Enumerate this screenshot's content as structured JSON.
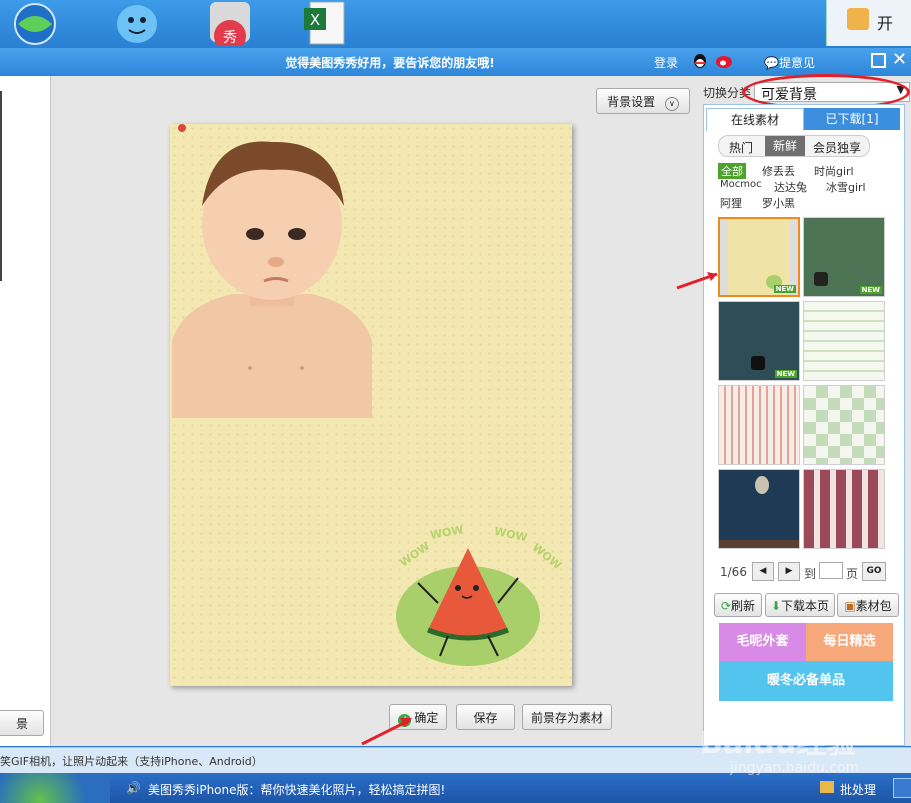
{
  "desktop": {
    "partial_label": "开",
    "icons": [
      "globe-icon",
      "qq-penguin-icon",
      "meitu-icon",
      "excel-icon"
    ]
  },
  "dialog": {
    "title": "觉得美图秀秀好用，要告诉您的朋友哦!",
    "login": "登录",
    "feedback": "提意见"
  },
  "toolbar": {
    "bg_settings": "背景设置"
  },
  "canvas": {
    "ribbon_text": "WOW"
  },
  "buttons": {
    "confirm": "确定",
    "save": "保存",
    "save_fg": "前景存为素材"
  },
  "sidebar": {
    "switch_label": "切换分类",
    "category_value": "可爱背景",
    "tabs": [
      "在线素材",
      "已下载[1]"
    ],
    "subtabs": [
      "热门",
      "新鲜",
      "会员独享"
    ],
    "filters": [
      "全部",
      "修丢丢",
      "时尚girl",
      "Mocmoc",
      "达达兔",
      "冰雪girl",
      "阿狸",
      "罗小黑"
    ],
    "pager": {
      "current": "1/66",
      "to": "到",
      "page": "页",
      "go": "GO"
    },
    "actions": [
      "刷新",
      "下载本页",
      "素材包"
    ],
    "banner": [
      "毛呢外套",
      "每日精选",
      "暖冬必备单品"
    ],
    "new_tag": "NEW"
  },
  "statusbar": {
    "left": "景",
    "marquee": "笑GIF相机，让照片动起来（支持iPhone、Android）"
  },
  "taskbar": {
    "news": "美图秀秀iPhone版：帮你快速美化照片，轻松搞定拼图!",
    "batch": "批处理"
  },
  "watermark": {
    "brand": "Baidu经验",
    "url": "jingyan.baidu.com"
  },
  "colors": {
    "accent": "#2c7fd3",
    "annotation_red": "#e3202a",
    "new_green": "#4ca22a"
  }
}
